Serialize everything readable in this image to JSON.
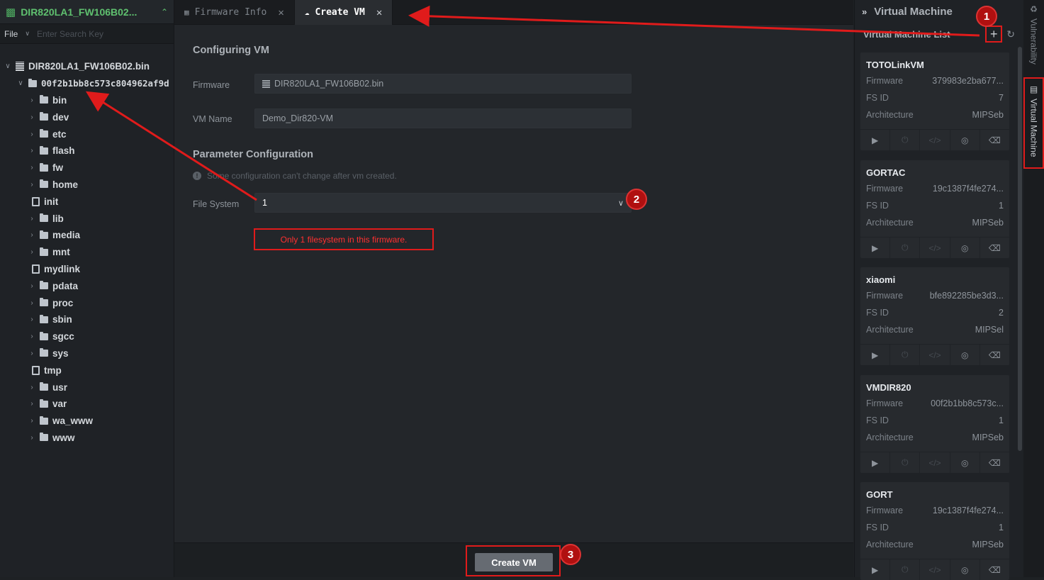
{
  "project": {
    "title": "DIR820LA1_FW106B02..."
  },
  "filebar": {
    "file_label": "File",
    "search_placeholder": "Enter Search Key"
  },
  "tree": {
    "root": "DIR820LA1_FW106B02.bin",
    "fs": "00f2b1bb8c573c804962af9d",
    "items": [
      {
        "name": "bin",
        "type": "folder"
      },
      {
        "name": "dev",
        "type": "folder"
      },
      {
        "name": "etc",
        "type": "folder"
      },
      {
        "name": "flash",
        "type": "folder"
      },
      {
        "name": "fw",
        "type": "folder"
      },
      {
        "name": "home",
        "type": "folder"
      },
      {
        "name": "init",
        "type": "file"
      },
      {
        "name": "lib",
        "type": "folder"
      },
      {
        "name": "media",
        "type": "folder"
      },
      {
        "name": "mnt",
        "type": "folder"
      },
      {
        "name": "mydlink",
        "type": "file"
      },
      {
        "name": "pdata",
        "type": "folder"
      },
      {
        "name": "proc",
        "type": "folder"
      },
      {
        "name": "sbin",
        "type": "folder"
      },
      {
        "name": "sgcc",
        "type": "folder"
      },
      {
        "name": "sys",
        "type": "folder"
      },
      {
        "name": "tmp",
        "type": "file"
      },
      {
        "name": "usr",
        "type": "folder"
      },
      {
        "name": "var",
        "type": "folder"
      },
      {
        "name": "wa_www",
        "type": "folder"
      },
      {
        "name": "www",
        "type": "folder"
      }
    ]
  },
  "tabs": [
    {
      "label": "Firmware Info",
      "active": false
    },
    {
      "label": "Create VM",
      "active": true
    }
  ],
  "form": {
    "heading": "Configuring VM",
    "firmware_label": "Firmware",
    "firmware_value": "DIR820LA1_FW106B02.bin",
    "vmname_label": "VM Name",
    "vmname_value": "Demo_Dir820-VM",
    "param_heading": "Parameter Configuration",
    "note": "Some configuration can't change after vm created.",
    "fs_label": "File System",
    "fs_value": "1",
    "warning": "Only 1 filesystem in this firmware.",
    "create_button": "Create VM"
  },
  "vm_panel": {
    "title": "Virtual Machine",
    "list_label": "Virtual Machine List",
    "plus": "+",
    "field_labels": {
      "firmware": "Firmware",
      "fsid": "FS ID",
      "arch": "Architecture"
    },
    "vms": [
      {
        "name": "TOTOLinkVM",
        "firmware": "379983e2ba677...",
        "fsid": "7",
        "arch": "MIPSeb"
      },
      {
        "name": "GORTAC",
        "firmware": "19c1387f4fe274...",
        "fsid": "1",
        "arch": "MIPSeb"
      },
      {
        "name": "xiaomi",
        "firmware": "bfe892285be3d3...",
        "fsid": "2",
        "arch": "MIPSel"
      },
      {
        "name": "VMDIR820",
        "firmware": "00f2b1bb8c573c...",
        "fsid": "1",
        "arch": "MIPSeb"
      },
      {
        "name": "GORT",
        "firmware": "19c1387f4fe274...",
        "fsid": "1",
        "arch": "MIPSeb"
      }
    ]
  },
  "side_tabs": {
    "vulnerability": "Vulnerability",
    "virtual_machine": "Virtual Machine"
  },
  "annotations": {
    "b1": "1",
    "b2": "2",
    "b3": "3"
  },
  "colors": {
    "annotation_red": "#e01b1b",
    "project_green": "#5fc06f"
  }
}
